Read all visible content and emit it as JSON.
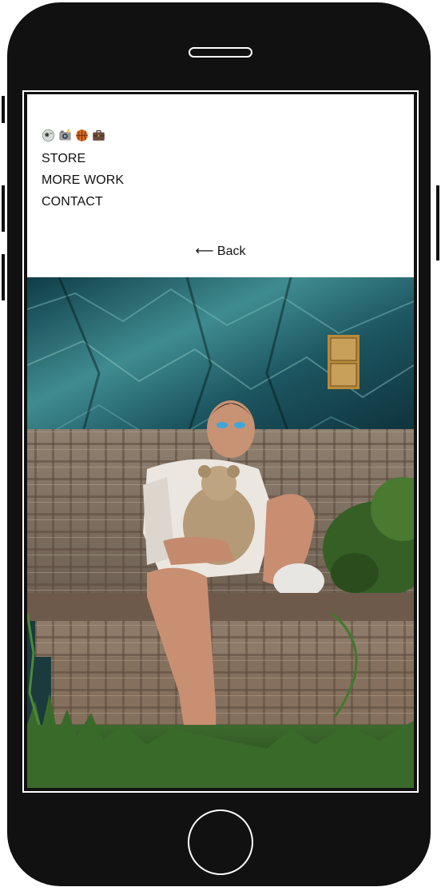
{
  "nav": {
    "emoji_icons": [
      "ghost-camera-icon",
      "camera-flash-icon",
      "basketball-icon",
      "briefcase-icon"
    ],
    "links": [
      {
        "label": "STORE"
      },
      {
        "label": "MORE WORK"
      },
      {
        "label": "CONTACT"
      }
    ]
  },
  "back_link": {
    "label": "⟵ Back"
  },
  "colors": {
    "device_body": "#111111",
    "device_outline": "#ffffff",
    "page_background": "#ffffff",
    "text": "#111111"
  }
}
